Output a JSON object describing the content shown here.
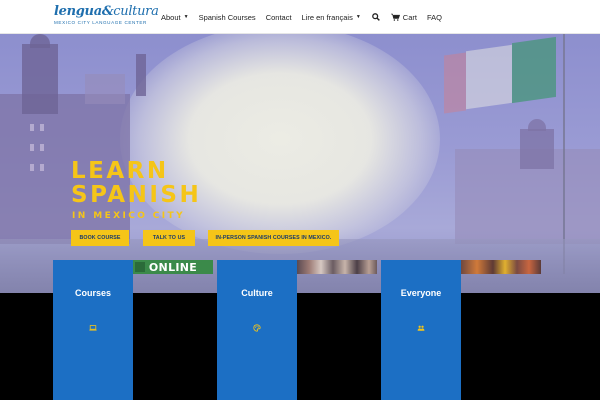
{
  "header": {
    "logo": {
      "main_part1": "lengua",
      "amp": "&",
      "main_part2": "cultura",
      "sub": "Mexico City Language Center"
    },
    "nav": [
      {
        "label": "About",
        "has_dropdown": true
      },
      {
        "label": "Spanish Courses",
        "has_dropdown": false
      },
      {
        "label": "Contact",
        "has_dropdown": false
      },
      {
        "label": "Lire en français",
        "has_dropdown": true
      }
    ],
    "search_icon": "search-icon",
    "cart": {
      "label": "Cart",
      "icon": "cart-icon"
    },
    "faq": "FAQ"
  },
  "hero": {
    "title_line1": "LEARN",
    "title_line2": "SPANISH",
    "subtitle": "IN MEXICO CITY",
    "buttons": [
      "BOOK COURSE",
      "TALK TO US",
      "IN-PERSON SPANISH COURSES IN MEXICO."
    ],
    "accent_color": "#f5c518"
  },
  "thumbnails": {
    "online_label": "ONLINE"
  },
  "cards": [
    {
      "title": "Courses",
      "icon": "laptop-icon"
    },
    {
      "title": "Culture",
      "icon": "palette-icon"
    },
    {
      "title": "Everyone",
      "icon": "people-icon"
    }
  ],
  "colors": {
    "card_blue": "#1c6fc4",
    "brand_blue": "#1f6fae"
  }
}
